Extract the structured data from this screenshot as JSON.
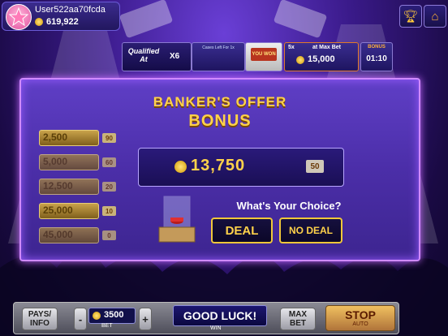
{
  "profile": {
    "username": "User522aa70fcda",
    "balance": "619,922"
  },
  "top_icons": {
    "trophy": "trophy-icon",
    "home": "home-icon"
  },
  "jackpot_strip": {
    "qualified_label": "Qualified At",
    "multiplier": "X6",
    "cases_left_label": "Cases Left For 1x",
    "you_won_label": "YOU WON",
    "max_bet_label": "at Max Bet",
    "max_bet_multiplier": "5x",
    "max_bet_prize": "15,000",
    "timer_label": "BONUS",
    "timer": "01:10"
  },
  "offer": {
    "title_line1": "BANKER'S OFFER",
    "title_line2": "BONUS",
    "value": "13,750",
    "case_number": "50"
  },
  "ladder": [
    {
      "value": "2,500",
      "case": "90"
    },
    {
      "value": "5,000",
      "case": "60"
    },
    {
      "value": "12,500",
      "case": "20"
    },
    {
      "value": "25,000",
      "case": "10"
    },
    {
      "value": "45,000",
      "case": "0"
    }
  ],
  "choice": {
    "prompt": "What's Your Choice?",
    "deal": "DEAL",
    "no_deal": "NO DEAL"
  },
  "bottom": {
    "pays_info": "PAYS/ INFO",
    "minus": "-",
    "bet_value": "3500",
    "bet_label": "BET",
    "plus": "+",
    "message": "GOOD LUCK!",
    "message_sub": "WIN",
    "max_bet": "MAX BET",
    "stop": "STOP",
    "stop_sub": "AUTO"
  },
  "colors": {
    "gold": "#ffd24a",
    "panel_border": "#d08aff",
    "accent_orange": "#e07a2a"
  }
}
